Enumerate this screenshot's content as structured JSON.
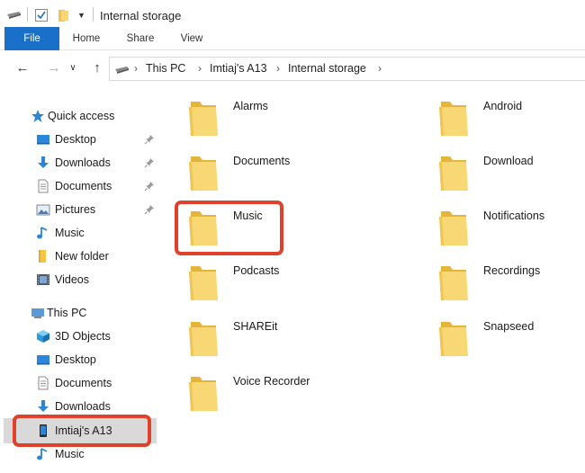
{
  "window": {
    "title": "Internal storage"
  },
  "ribbon": {
    "tabs": [
      {
        "label": "File"
      },
      {
        "label": "Home"
      },
      {
        "label": "Share"
      },
      {
        "label": "View"
      }
    ]
  },
  "address": {
    "crumbs": [
      "This PC",
      "Imtiaj's A13",
      "Internal storage"
    ]
  },
  "navpane": {
    "quick_access": "Quick access",
    "quick_items": [
      {
        "label": "Desktop",
        "icon": "desktop-icon"
      },
      {
        "label": "Downloads",
        "icon": "download-icon"
      },
      {
        "label": "Documents",
        "icon": "documents-icon"
      },
      {
        "label": "Pictures",
        "icon": "pictures-icon"
      },
      {
        "label": "Music",
        "icon": "music-icon"
      },
      {
        "label": "New folder",
        "icon": "folder-icon"
      },
      {
        "label": "Videos",
        "icon": "videos-icon"
      }
    ],
    "this_pc": "This PC",
    "pc_items": [
      {
        "label": "3D Objects",
        "icon": "3d-objects-icon"
      },
      {
        "label": "Desktop",
        "icon": "desktop-icon"
      },
      {
        "label": "Documents",
        "icon": "documents-icon"
      },
      {
        "label": "Downloads",
        "icon": "download-icon"
      },
      {
        "label": "Imtiaj's A13",
        "icon": "phone-icon"
      },
      {
        "label": "Music",
        "icon": "music-icon"
      }
    ]
  },
  "folders": [
    {
      "name": "Alarms"
    },
    {
      "name": "Android"
    },
    {
      "name": "Documents"
    },
    {
      "name": "Download"
    },
    {
      "name": "Music"
    },
    {
      "name": "Notifications"
    },
    {
      "name": "Podcasts"
    },
    {
      "name": "Recordings"
    },
    {
      "name": "SHAREit"
    },
    {
      "name": "Snapseed"
    },
    {
      "name": "Voice Recorder"
    }
  ],
  "colors": {
    "accent": "#1a6fc9",
    "highlight": "#e0412a",
    "folder": "#f5c542",
    "selected": "#d9d9d9"
  }
}
